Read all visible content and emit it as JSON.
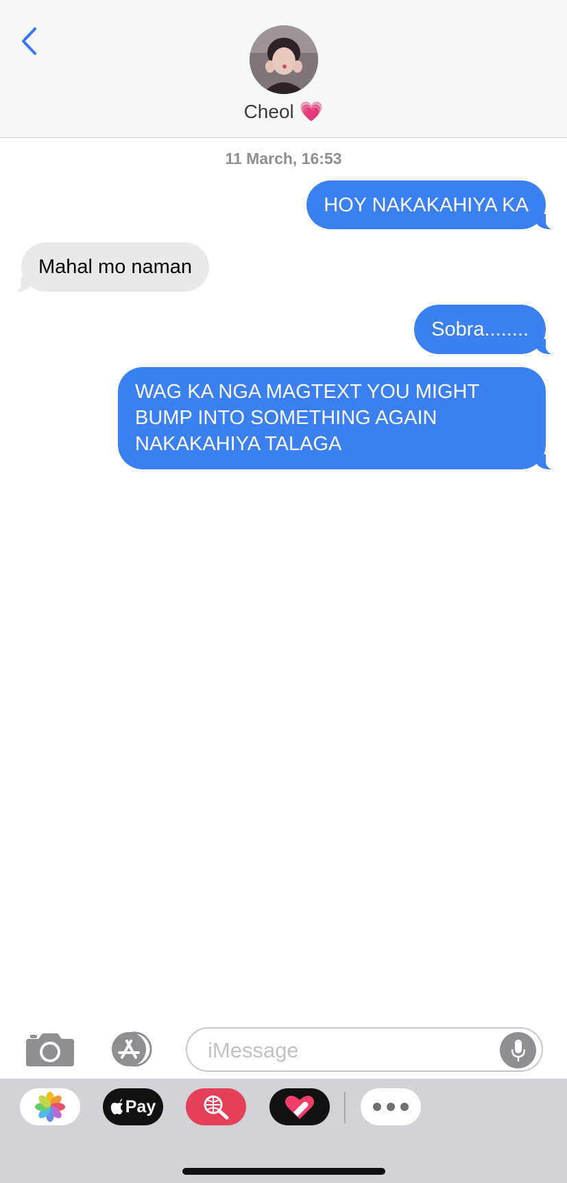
{
  "header": {
    "contact_name": "Cheol",
    "contact_emoji": "💗",
    "back_icon": "chevron-left-icon"
  },
  "conversation": {
    "timestamp": "11 March, 16:53",
    "messages": [
      {
        "direction": "sent",
        "text": "HOY NAKAKAHIYA KA"
      },
      {
        "direction": "received",
        "text": "Mahal mo naman"
      },
      {
        "direction": "sent",
        "text": "Sobra........"
      },
      {
        "direction": "sent",
        "text": "WAG KA NGA MAGTEXT YOU MIGHT BUMP INTO SOMETHING AGAIN NAKAKAHIYA TALAGA"
      }
    ]
  },
  "composer": {
    "placeholder": "iMessage",
    "value": "",
    "icons": [
      "camera-icon",
      "app-store-icon",
      "microphone-icon"
    ]
  },
  "app_drawer": {
    "apps": [
      {
        "name": "photos-icon"
      },
      {
        "name": "apple-pay-icon",
        "label": "Pay"
      },
      {
        "name": "image-search-icon"
      },
      {
        "name": "digital-touch-icon"
      },
      {
        "name": "more-apps-icon"
      }
    ]
  },
  "colors": {
    "sent_bubble": "#3b80f1",
    "received_bubble": "#e9e9eb",
    "accent": "#3478f6"
  }
}
